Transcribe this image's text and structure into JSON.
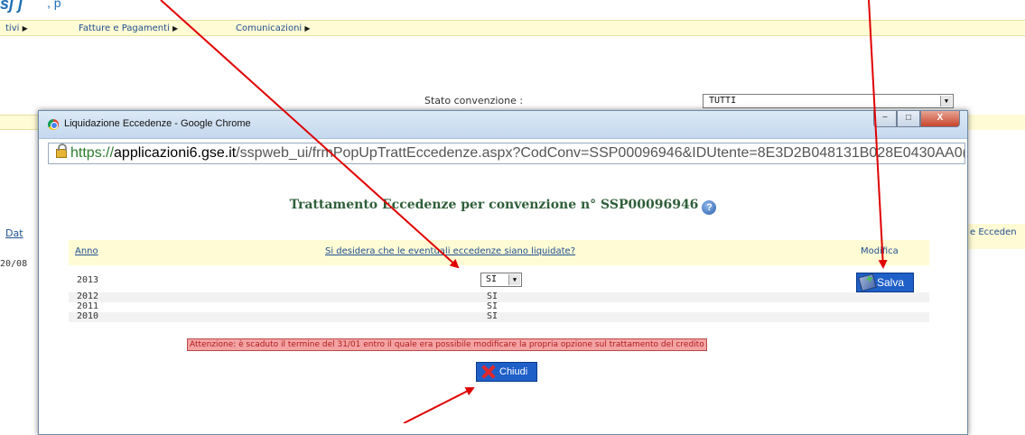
{
  "background": {
    "header_fragment_bold": "sj j",
    "header_fragment_rest": ", p",
    "menu": [
      {
        "label": "tivi"
      },
      {
        "label": "Fatture e Pagamenti"
      },
      {
        "label": "Comunicazioni"
      }
    ],
    "stato_label": "Stato convenzione :",
    "stato_value": "TUTTI",
    "dat_link": "Dat",
    "date_fragment": "20/08",
    "right_col_fragment": "e Ecceden"
  },
  "window": {
    "title": "Liquidazione Eccedenze - Google Chrome",
    "url_scheme": "https://",
    "url_host": "applicazioni6.gse.it",
    "url_path": "/sspweb_ui/frmPopUpTrattEccedenze.aspx?CodConv=SSP00096946&IDUtente=8E3D2B048131B028E0430AA0(",
    "min_label": "−",
    "max_label": "□",
    "close_label": "X"
  },
  "page": {
    "heading": "Trattamento Eccedenze per convenzione n° SSP00096946",
    "help_glyph": "?",
    "columns": {
      "anno": "Anno",
      "question": "Si desidera che le eventuali eccedenze siano liquidate?",
      "modifica": "Modifica"
    },
    "rows": [
      {
        "year": "2013",
        "value": "SI",
        "editable": true
      },
      {
        "year": "2012",
        "value": "SI"
      },
      {
        "year": "2011",
        "value": "SI"
      },
      {
        "year": "2010",
        "value": "SI"
      }
    ],
    "salva_label": "Salva",
    "warning": "Attenzione: è scaduto il termine del 31/01 entro il quale era possibile modificare la propria opzione sul trattamento del credito",
    "chiudi_label": "Chiudi"
  },
  "colors": {
    "arrow": "#e00000",
    "button_blue": "#1f5fc8",
    "table_header_bg": "#fffbd5",
    "heading_green": "#2f5f3a",
    "warning_bg": "#f4a3a3"
  }
}
